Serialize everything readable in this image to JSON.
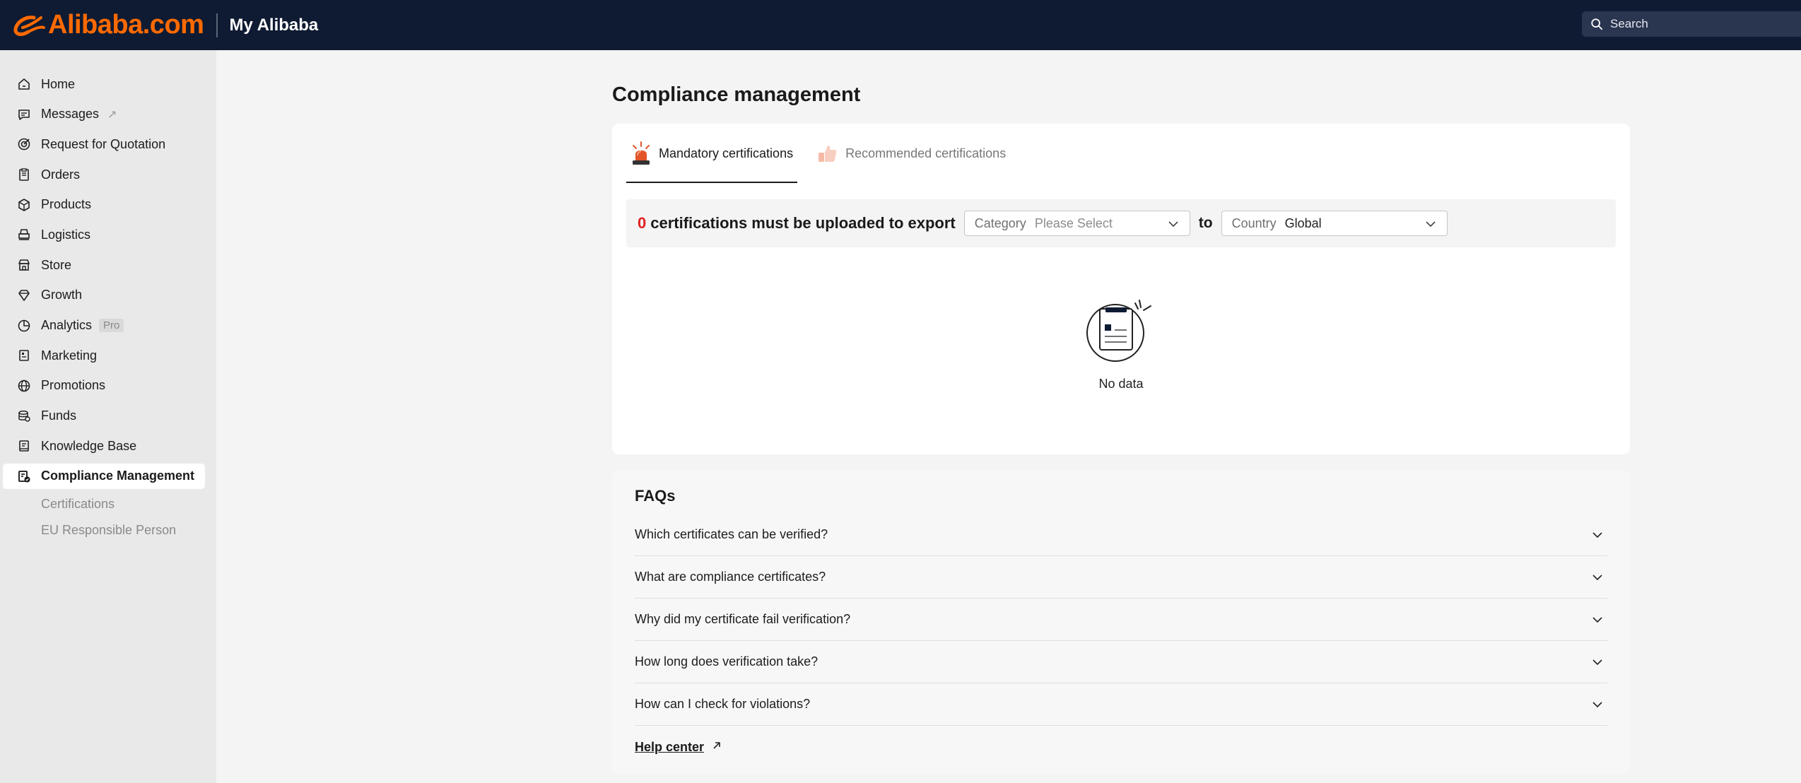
{
  "header": {
    "logo_text": "Alibaba.com",
    "brand_title": "My Alibaba",
    "search_placeholder": "Search"
  },
  "sidebar": {
    "items": [
      {
        "label": "Home",
        "icon": "home-icon"
      },
      {
        "label": "Messages",
        "icon": "message-icon",
        "external_mark": "↗"
      },
      {
        "label": "Request for Quotation",
        "icon": "target-icon"
      },
      {
        "label": "Orders",
        "icon": "clipboard-icon"
      },
      {
        "label": "Products",
        "icon": "box-icon"
      },
      {
        "label": "Logistics",
        "icon": "truck-icon"
      },
      {
        "label": "Store",
        "icon": "store-icon"
      },
      {
        "label": "Growth",
        "icon": "diamond-icon"
      },
      {
        "label": "Analytics",
        "icon": "pie-chart-icon",
        "badge": "Pro"
      },
      {
        "label": "Marketing",
        "icon": "marketing-icon"
      },
      {
        "label": "Promotions",
        "icon": "globe-icon"
      },
      {
        "label": "Funds",
        "icon": "coins-icon"
      },
      {
        "label": "Knowledge Base",
        "icon": "book-icon"
      },
      {
        "label": "Compliance Management",
        "icon": "compliance-icon",
        "active": true
      }
    ],
    "sub_items": [
      {
        "label": "Certifications"
      },
      {
        "label": "EU Responsible Person"
      }
    ]
  },
  "main": {
    "page_title": "Compliance management",
    "tabs": [
      {
        "label": "Mandatory certifications",
        "icon": "alarm-icon",
        "active": true
      },
      {
        "label": "Recommended certifications",
        "icon": "thumbs-up-icon",
        "active": false
      }
    ],
    "filter": {
      "count": "0",
      "text": "certifications must be uploaded to export",
      "category_label": "Category",
      "category_value": "Please Select",
      "to_text": "to",
      "country_label": "Country",
      "country_value": "Global"
    },
    "empty_text": "No data"
  },
  "faq": {
    "title": "FAQs",
    "items": [
      "Which certificates can be verified?",
      "What are compliance certificates?",
      "Why did my certificate fail verification?",
      "How long does verification take?",
      "How can I check for violations?"
    ],
    "help_center": "Help center"
  },
  "colors": {
    "header_bg": "#0f1b33",
    "brand_orange": "#ff6a00",
    "count_red": "#e02020"
  }
}
